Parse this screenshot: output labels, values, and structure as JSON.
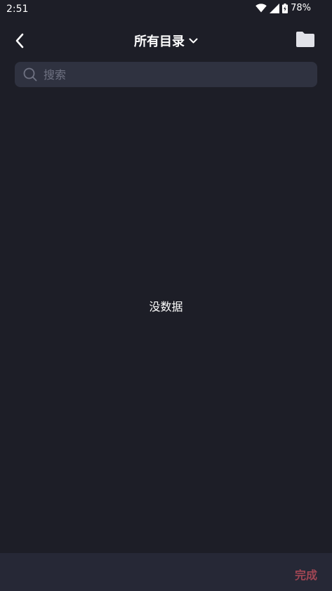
{
  "status_bar": {
    "time": "2:51",
    "battery": "78%",
    "icons": [
      "wifi-icon",
      "signal-icon",
      "battery-charging-icon"
    ]
  },
  "header": {
    "title": "所有目录",
    "back_icon": "back-arrow-icon",
    "dropdown_icon": "chevron-down-icon",
    "folder_icon": "folder-icon"
  },
  "search": {
    "placeholder": "搜索",
    "value": "",
    "icon": "search-icon"
  },
  "main": {
    "empty_text": "没数据"
  },
  "footer": {
    "done_label": "完成",
    "done_color": "#a14654"
  },
  "colors": {
    "background": "#1d1e27",
    "search_background": "#2f3240",
    "footer_background": "#262836",
    "accent": "#a14654"
  }
}
